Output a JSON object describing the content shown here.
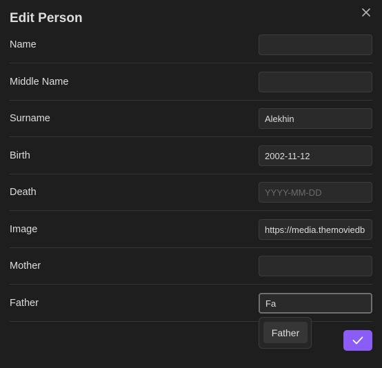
{
  "modal": {
    "title": "Edit Person",
    "close_icon": "close-icon"
  },
  "fields": [
    {
      "label": "Name",
      "value": "",
      "placeholder": ""
    },
    {
      "label": "Middle Name",
      "value": "",
      "placeholder": ""
    },
    {
      "label": "Surname",
      "value": "Alekhin",
      "placeholder": ""
    },
    {
      "label": "Birth",
      "value": "2002-11-12",
      "placeholder": ""
    },
    {
      "label": "Death",
      "value": "",
      "placeholder": "YYYY-MM-DD"
    },
    {
      "label": "Image",
      "value": "https://media.themoviedb",
      "placeholder": ""
    },
    {
      "label": "Mother",
      "value": "",
      "placeholder": ""
    },
    {
      "label": "Father",
      "value": "Fa",
      "placeholder": ""
    }
  ],
  "suggestion": {
    "items": [
      "Father"
    ]
  },
  "confirm": {
    "icon": "check-icon",
    "color": "#8b5cf6"
  }
}
